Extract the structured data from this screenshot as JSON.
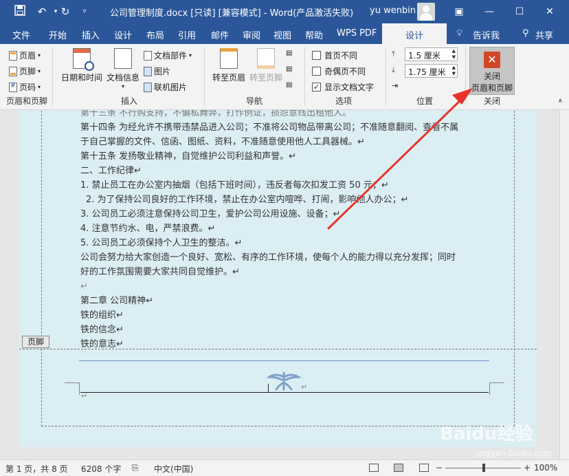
{
  "titlebar": {
    "title": "公司管理制度.docx [只读] [兼容模式]  -  Word(产品激活失败)",
    "user": "yu wenbin",
    "save_icon": "save-icon",
    "undo_icon": "undo-icon",
    "redo_icon": "redo-icon"
  },
  "tabs": [
    "文件",
    "开始",
    "插入",
    "设计",
    "布局",
    "引用",
    "邮件",
    "审阅",
    "视图",
    "帮助",
    "WPS PDF",
    "设计",
    "告诉我",
    "共享"
  ],
  "ribbon": {
    "hf": {
      "header": "页眉",
      "footer": "页脚",
      "pagenum": "页码",
      "label": "页眉和页脚"
    },
    "insert": {
      "datetime": "日期和时间",
      "docinfo": "文档信息",
      "docparts": "文档部件",
      "picture": "图片",
      "online": "联机图片",
      "label": "插入"
    },
    "nav": {
      "goheader": "转至页眉",
      "gofooter": "转至页脚",
      "label": "导航"
    },
    "options": {
      "first": "首页不同",
      "oddeven": "奇偶页不同",
      "showtext": "显示文档文字",
      "label": "选项"
    },
    "position": {
      "top": "1.5 厘米",
      "bottom": "1.75 厘米",
      "label": "位置"
    },
    "close": {
      "line1": "关闭",
      "line2": "页眉和页脚",
      "label": "关闭"
    }
  },
  "document": {
    "lines": [
      "第十三条 不行购支持，不偏私舞弊，打作例证，损怨意线出租他人。",
      "第十四条 为经允许不携带违禁品进入公司；不准将公司物品带离公司；不准随意翻阅、查看不属",
      "于自己掌握的文件、信函、图纸、资料，不准随意使用他人工具器械。↵",
      "第十五条 发扬敬业精神，自觉维护公司利益和声誉。↵",
      "二、工作纪律↵",
      "1. 禁止员工在办公室内抽烟（包括下班时间），违反者每次扣发工资 50 元；↵",
      "2. 为了保持公司良好的工作环境，禁止在办公室内喧哗、打闹，影响他人办公；↵",
      "3. 公司员工必须注意保持公司卫生，爱护公司公用设施、设备；↵",
      "4. 注意节约水、电，严禁浪费。↵",
      "5. 公司员工必须保持个人卫生的整洁。↵",
      "公司会努力给大家创造一个良好、宽松、有序的工作环境，使每个人的能力得以充分发挥；同时",
      "好的工作氛围需要大家共同自觉维护。↵",
      "↵",
      "第二章     公司精神↵",
      "铁的组织↵",
      "铁的信念↵",
      "铁的意志↵"
    ],
    "footer_tag": "页脚",
    "para_mark": "↵"
  },
  "status": {
    "page": "第 1 页，共 8 页",
    "words": "6208 个字",
    "lang": "中文(中国)",
    "zoom": "100%"
  },
  "watermark": {
    "main": "Baidu经验",
    "sub": "jingyan.baidu.com"
  }
}
